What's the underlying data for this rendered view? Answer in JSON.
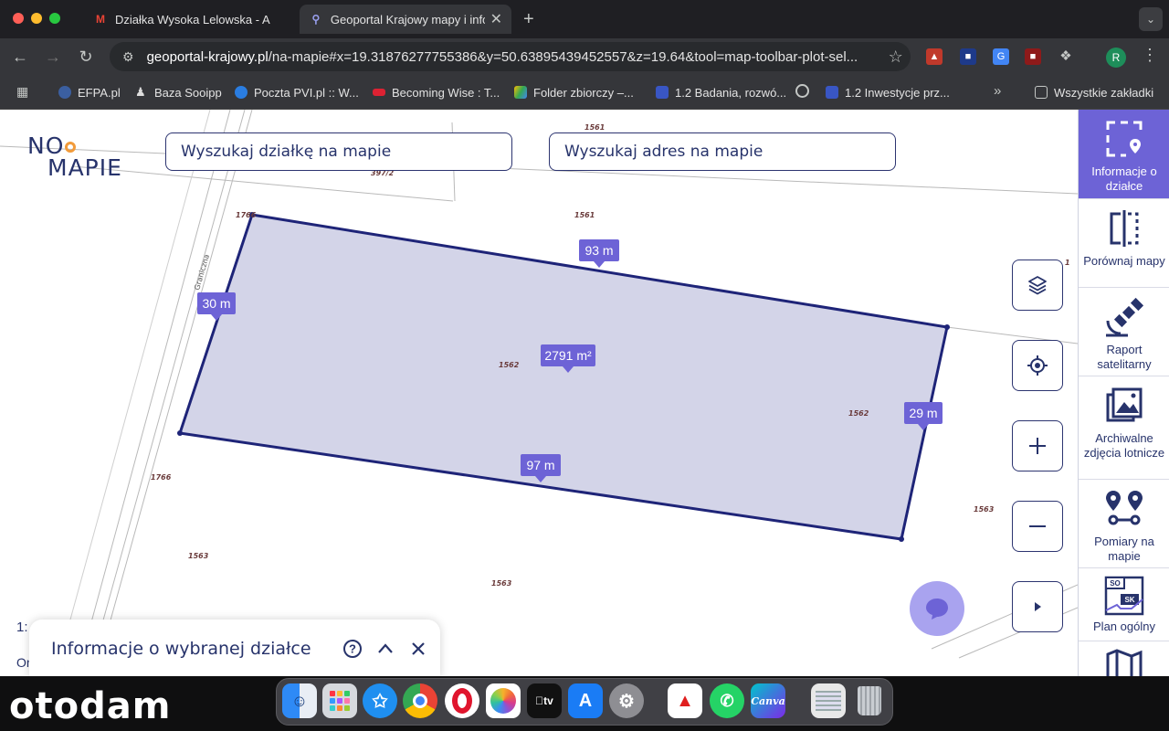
{
  "browser": {
    "tabs": [
      {
        "title": "Działka Wysoka Lelowska - A",
        "active": false
      },
      {
        "title": "Geoportal Krajowy mapy i info",
        "active": true
      }
    ],
    "url_domain": "geoportal-krajowy.pl",
    "url_path": "/na-mapie#x=19.31876277755386&y=50.63895439452557&z=19.64&tool=map-toolbar-plot-sel...",
    "profile_initial": "R",
    "bookmarks": [
      "EFPA.pl",
      "Baza Sooipp",
      "Poczta PVI.pl :: W...",
      "Becoming Wise : T...",
      "Folder zbiorczy –...",
      "1.2 Badania, rozwó...",
      "1.2 Inwestycje prz...",
      "Wszystkie zakładki"
    ]
  },
  "app": {
    "logo": {
      "line1": "NO",
      "line2": "MAPIE"
    },
    "search_plot": "Wyszukaj działkę na mapie",
    "search_address": "Wyszukaj adres na mapie",
    "info_panel_title": "Informacje o wybranej działce",
    "scale_prefix": "1:",
    "scale_line2": "Or"
  },
  "map": {
    "parcel_labels": [
      "1561",
      "397/2",
      "1561",
      "1766",
      "1562",
      "1562",
      "1766",
      "1563",
      "1563",
      "1563",
      "1"
    ],
    "street_label": "Graniczna",
    "measurements": {
      "top": "93 m",
      "left": "30 m",
      "right": "29 m",
      "bottom": "97 m",
      "area": "2791 m²"
    },
    "parcel_fill": "#d3d4e8",
    "parcel_stroke": "#1e2478",
    "label_color": "#6d63d6"
  },
  "sidebar": [
    {
      "label": "Informacje o działce",
      "icon": "plot-info-icon",
      "active": true
    },
    {
      "label": "Porównaj mapy",
      "icon": "compare-maps-icon",
      "active": false
    },
    {
      "label": "Raport satelitarny",
      "icon": "satellite-icon",
      "active": false
    },
    {
      "label": "Archiwalne zdjęcia lotnicze",
      "icon": "gallery-icon",
      "active": false
    },
    {
      "label": "Pomiary na mapie",
      "icon": "measure-icon",
      "active": false
    },
    {
      "label": "Plan ogólny",
      "icon": "general-plan-icon",
      "active": false
    }
  ],
  "watermark": "otodam",
  "dock_apps": [
    "Finder",
    "Launchpad",
    "Safari",
    "Chrome",
    "Opera",
    "Photos",
    "TV",
    "App Store",
    "Settings",
    "Acrobat",
    "WhatsApp",
    "Canva",
    "Preview",
    "Trash"
  ]
}
